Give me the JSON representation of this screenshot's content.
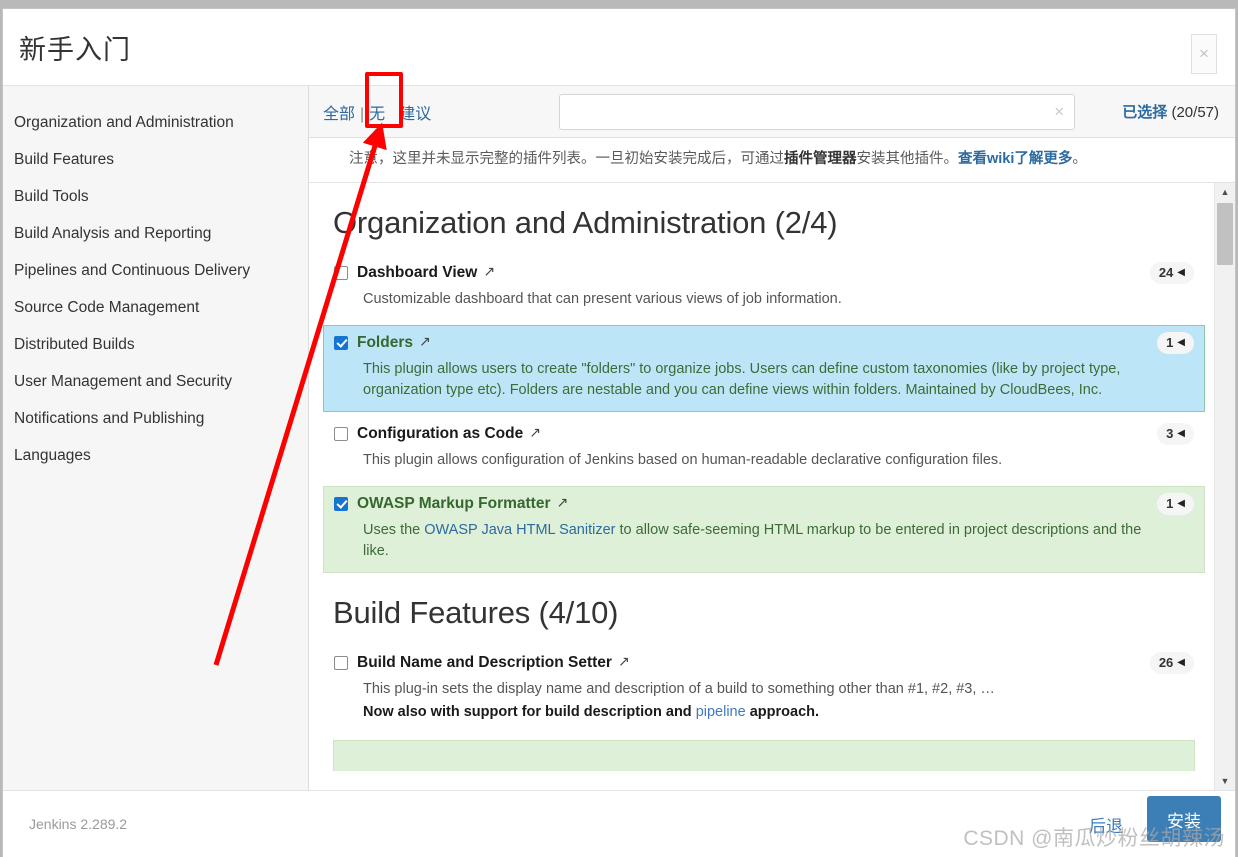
{
  "dialog": {
    "title": "新手入门",
    "close_label": "×"
  },
  "sidebar": {
    "items": [
      {
        "label": "Organization and Administration"
      },
      {
        "label": "Build Features"
      },
      {
        "label": "Build Tools"
      },
      {
        "label": "Build Analysis and Reporting"
      },
      {
        "label": "Pipelines and Continuous Delivery"
      },
      {
        "label": "Source Code Management"
      },
      {
        "label": "Distributed Builds"
      },
      {
        "label": "User Management and Security"
      },
      {
        "label": "Notifications and Publishing"
      },
      {
        "label": "Languages"
      }
    ]
  },
  "filterbar": {
    "all_label": "全部",
    "separator": "|",
    "none_label": "无",
    "suggested_label": "建议",
    "search_value": "",
    "search_placeholder": "",
    "clear_icon": "×",
    "selected_label": "已选择",
    "selected_count": "(20/57)"
  },
  "notice": {
    "prefix": "注意，这里并未显示完整的插件列表。一旦初始安装完成后，可通过",
    "bold": "插件管理器",
    "middle": "安装其他插件。",
    "link": "查看wiki了解更多",
    "suffix": "。"
  },
  "sections": [
    {
      "title": "Organization and Administration (2/4)",
      "plugins": [
        {
          "name": "Dashboard View",
          "external_icon": "↗",
          "checked": false,
          "highlight": "none",
          "badge": "24",
          "badge_tri": "◀",
          "description": "Customizable dashboard that can present various views of job information."
        },
        {
          "name": "Folders",
          "external_icon": "↗",
          "checked": true,
          "highlight": "blue",
          "badge": "1",
          "badge_tri": "◀",
          "description": "This plugin allows users to create \"folders\" to organize jobs. Users can define custom taxonomies (like by project type, organization type etc). Folders are nestable and you can define views within folders. Maintained by CloudBees, Inc."
        },
        {
          "name": "Configuration as Code",
          "external_icon": "↗",
          "checked": false,
          "highlight": "none",
          "badge": "3",
          "badge_tri": "◀",
          "description": "This plugin allows configuration of Jenkins based on human-readable declarative configuration files."
        },
        {
          "name": "OWASP Markup Formatter",
          "external_icon": "↗",
          "checked": true,
          "highlight": "green",
          "badge": "1",
          "badge_tri": "◀",
          "desc_pre": "Uses the ",
          "desc_link": "OWASP Java HTML Sanitizer",
          "desc_post": " to allow safe-seeming HTML markup to be entered in project descriptions and the like."
        }
      ]
    },
    {
      "title": "Build Features (4/10)",
      "plugins": [
        {
          "name": "Build Name and Description Setter",
          "external_icon": "↗",
          "checked": false,
          "highlight": "none",
          "badge": "26",
          "badge_tri": "◀",
          "description": "This plug-in sets the display name and description of a build to something other than #1, #2, #3, …",
          "desc_bold_pre": "Now also with support for build description and ",
          "desc_bold_link": "pipeline",
          "desc_bold_post": " approach."
        }
      ]
    }
  ],
  "scrollbar": {
    "up_arrow": "▲",
    "down_arrow": "▼"
  },
  "footer": {
    "version": "Jenkins 2.289.2",
    "back_label": "后退",
    "install_label": "安装",
    "watermark": "CSDN @南瓜炒粉丝胡辣汤"
  },
  "colors": {
    "accent_blue": "#3c7fb6",
    "link_blue": "#2c6aa0",
    "selected_blue_bg": "#bce6f7",
    "selected_green_bg": "#dff0d8",
    "checkbox_checked": "#1675d1",
    "annotation_red": "#ff0000"
  }
}
